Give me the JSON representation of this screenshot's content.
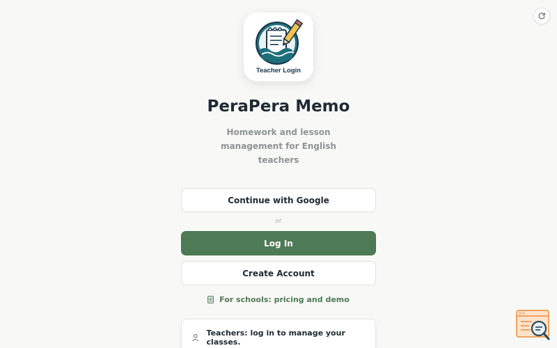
{
  "header": {
    "refresh_icon": "refresh-icon",
    "logo_caption": "Teacher Login",
    "logo_icon": "notepad-pencil-logo",
    "title": "PeraPera Memo",
    "subtitle": "Homework and lesson management for English teachers"
  },
  "auth": {
    "google_label": "Continue with Google",
    "divider_text": "or",
    "login_label": "Log In",
    "create_label": "Create Account"
  },
  "schools_link": {
    "icon": "notebook-icon",
    "label": "For schools: pricing and demo"
  },
  "info_card": {
    "icon": "person-icon",
    "text": "Teachers: log in to manage your classes."
  },
  "helper": {
    "icon": "search-window-icon"
  },
  "colors": {
    "accent": "#4e7a56",
    "background": "#f8f8f6",
    "title": "#1f2a33",
    "subtitle": "#8d9396",
    "helper_orange": "#f0a35e"
  }
}
